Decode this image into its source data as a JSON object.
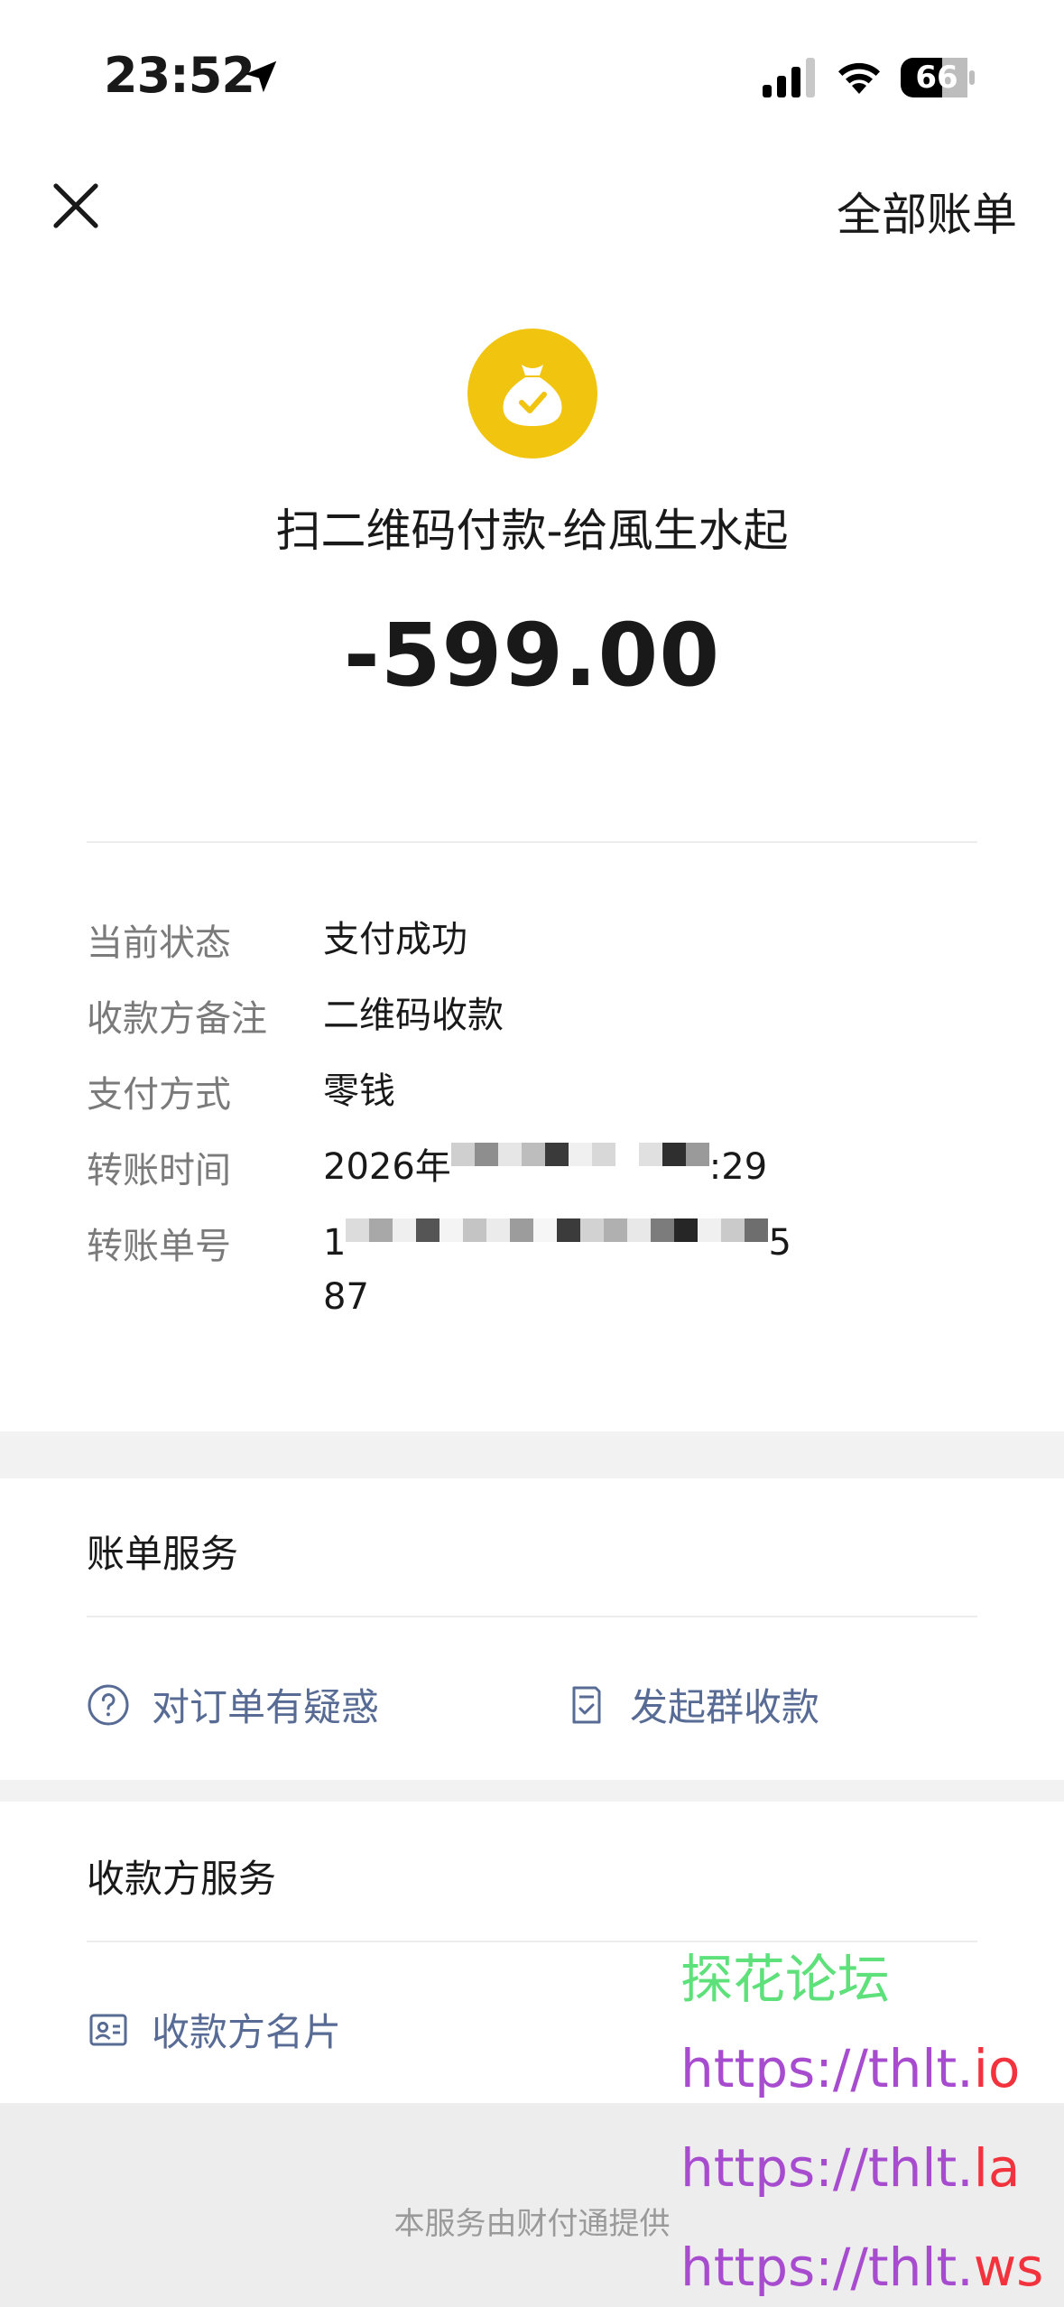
{
  "status_bar": {
    "time": "23:52",
    "battery": "66",
    "icons": [
      "location-arrow-icon",
      "cellular-signal-icon",
      "wifi-icon",
      "battery-icon"
    ]
  },
  "nav": {
    "close_icon": "close-icon",
    "all_bills_label": "全部账单"
  },
  "header": {
    "icon": "money-bag-check-icon",
    "icon_color": "#f1c40f",
    "title": "扫二维码付款-给風生水起",
    "amount": "-599.00"
  },
  "details": {
    "rows": [
      {
        "label": "当前状态",
        "value": "支付成功"
      },
      {
        "label": "收款方备注",
        "value": "二维码收款"
      },
      {
        "label": "支付方式",
        "value": "零钱"
      },
      {
        "label": "转账时间",
        "value_prefix": "2026年",
        "value_suffix": ":29"
      },
      {
        "label": "转账单号",
        "value_prefix": "1",
        "value_suffix": "5",
        "value_line2": "87"
      }
    ]
  },
  "bill_service": {
    "title": "账单服务",
    "actions": [
      {
        "label": "对订单有疑惑",
        "icon": "question-circle-icon"
      },
      {
        "label": "发起群收款",
        "icon": "receipt-check-icon"
      }
    ]
  },
  "payee_service": {
    "title": "收款方服务",
    "actions": [
      {
        "label": "收款方名片",
        "icon": "contact-card-icon"
      }
    ]
  },
  "footer": {
    "text": "本服务由财付通提供"
  },
  "watermark": {
    "name": "探花论坛",
    "urls": [
      {
        "base": "https://thlt.",
        "tld": "io"
      },
      {
        "base": "https://thlt.",
        "tld": "la"
      },
      {
        "base": "https://thlt.",
        "tld": "ws"
      }
    ]
  },
  "colors": {
    "link": "#576b95",
    "label_gray": "#7a7a7a",
    "separator": "#f2f2f2",
    "watermark_green": "#5ee07a",
    "watermark_purple": "#a84ccf",
    "watermark_red": "#f2323c"
  }
}
